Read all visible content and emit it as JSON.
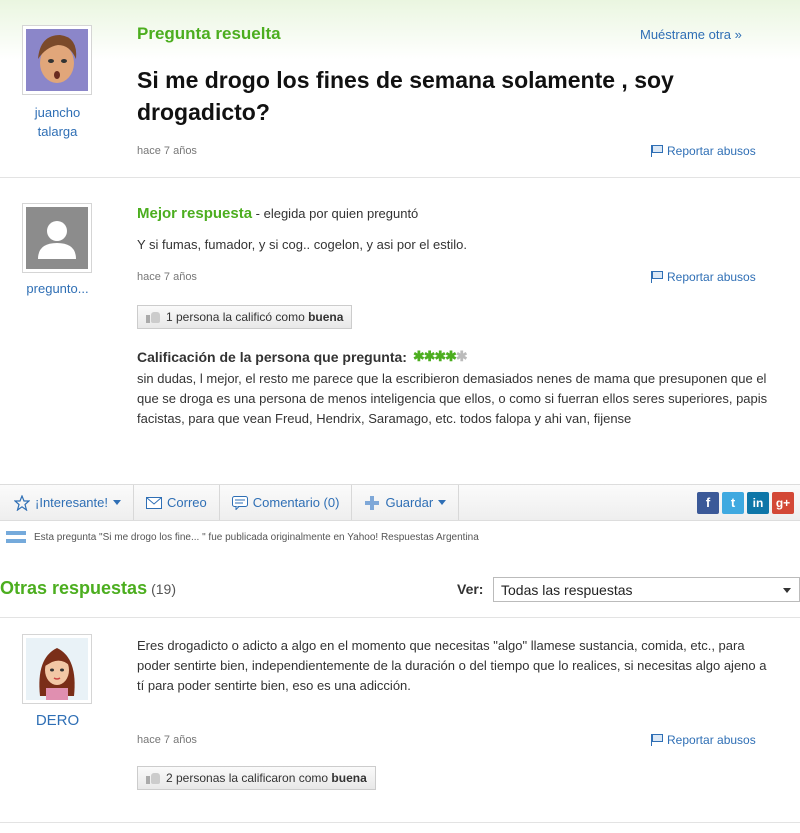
{
  "question": {
    "status": "Pregunta resuelta",
    "show_another": "Muéstrame otra »",
    "user": [
      "juancho",
      "talarga"
    ],
    "title": "Si me drogo los fines de semana solamente , soy drogadicto?",
    "time": "hace 7 años",
    "report": "Reportar abusos"
  },
  "best_answer": {
    "heading": "Mejor respuesta",
    "chosen_by": " - elegida por quien preguntó",
    "user": "pregunto...",
    "text": "Y si fumas, fumador, y si cog.. cogelon, y asi por el estilo.",
    "time": "hace 7 años",
    "report": "Reportar abusos",
    "vote_prefix": "1 persona la calificó como ",
    "vote_word": "buena",
    "rating_label": "Calificación de la persona que pregunta:",
    "rating_stars": 4,
    "rating_max": 5,
    "rating_text": "sin dudas, l mejor, el resto me parece que la escribieron demasiados nenes de mama que presuponen que el que se droga es una persona de menos inteligencia que ellos, o como si fuerran ellos seres superiores, papis facistas, para que vean Freud, Hendrix, Saramago, etc. todos falopa y ahi van, fijense"
  },
  "actions": {
    "interesting": "¡Interesante!",
    "email": "Correo",
    "comment": "Comentario (0)",
    "save": "Guardar",
    "social": [
      "f",
      "t",
      "in",
      "g+"
    ]
  },
  "origin_notice": "Esta pregunta \"Si me drogo los fine... \" fue publicada originalmente en Yahoo! Respuestas Argentina",
  "other_answers": {
    "heading": "Otras respuestas",
    "count": "(19)",
    "view_label": "Ver:",
    "view_value": "Todas las respuestas",
    "items": [
      {
        "user": "DERO",
        "text": "Eres drogadicto o adicto a algo en el momento que necesitas \"algo\" llamese sustancia, comida, etc., para poder sentirte bien, independientemente de la duración o del tiempo que lo realices, si necesitas algo ajeno a tí para poder sentirte bien, eso es una adicción.",
        "time": "hace 7 años",
        "report": "Reportar abusos",
        "vote_prefix": "2 personas la calificaron como ",
        "vote_word": "buena"
      }
    ]
  },
  "colors": {
    "green": "#4cae1f",
    "link": "#2f6fb5",
    "facebook": "#3b5998",
    "twitter": "#3fa9e0",
    "linkedin": "#0e76a8",
    "googleplus": "#d34836"
  }
}
